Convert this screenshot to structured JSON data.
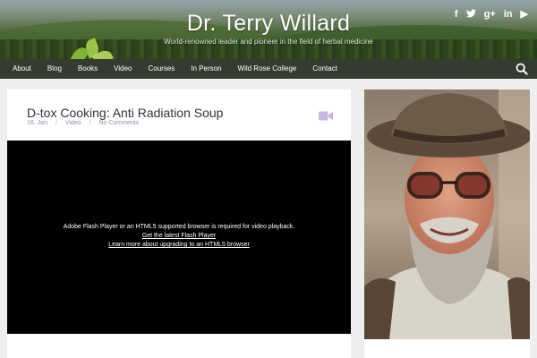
{
  "site": {
    "title": "Dr. Terry Willard",
    "tagline": "World-renowned leader and pioneer in the field of herbal medicine"
  },
  "social": [
    {
      "name": "facebook-icon",
      "glyph": "f"
    },
    {
      "name": "twitter-icon",
      "glyph": "t"
    },
    {
      "name": "google-plus-icon",
      "glyph": "g+"
    },
    {
      "name": "linkedin-icon",
      "glyph": "in"
    },
    {
      "name": "youtube-icon",
      "glyph": "▶"
    }
  ],
  "nav": {
    "items": [
      "About",
      "Blog",
      "Books",
      "Video",
      "Courses",
      "In Person",
      "Wild Rose College",
      "Contact"
    ]
  },
  "post": {
    "title": "D-tox Cooking: Anti Radiation Soup",
    "date": "16. Jan",
    "category": "Video",
    "comments": "No Comments",
    "separator": "/"
  },
  "player": {
    "message": "Adobe Flash Player or an HTML5 supported browser is required for video playback.",
    "link_flash": "Get the latest Flash Player",
    "link_html5": "Learn more about upgrading to an HTML5 browser"
  },
  "colors": {
    "nav_bg": "#232d1e",
    "meta_text": "#8a8fb8",
    "video_icon": "#c9b6e8"
  }
}
